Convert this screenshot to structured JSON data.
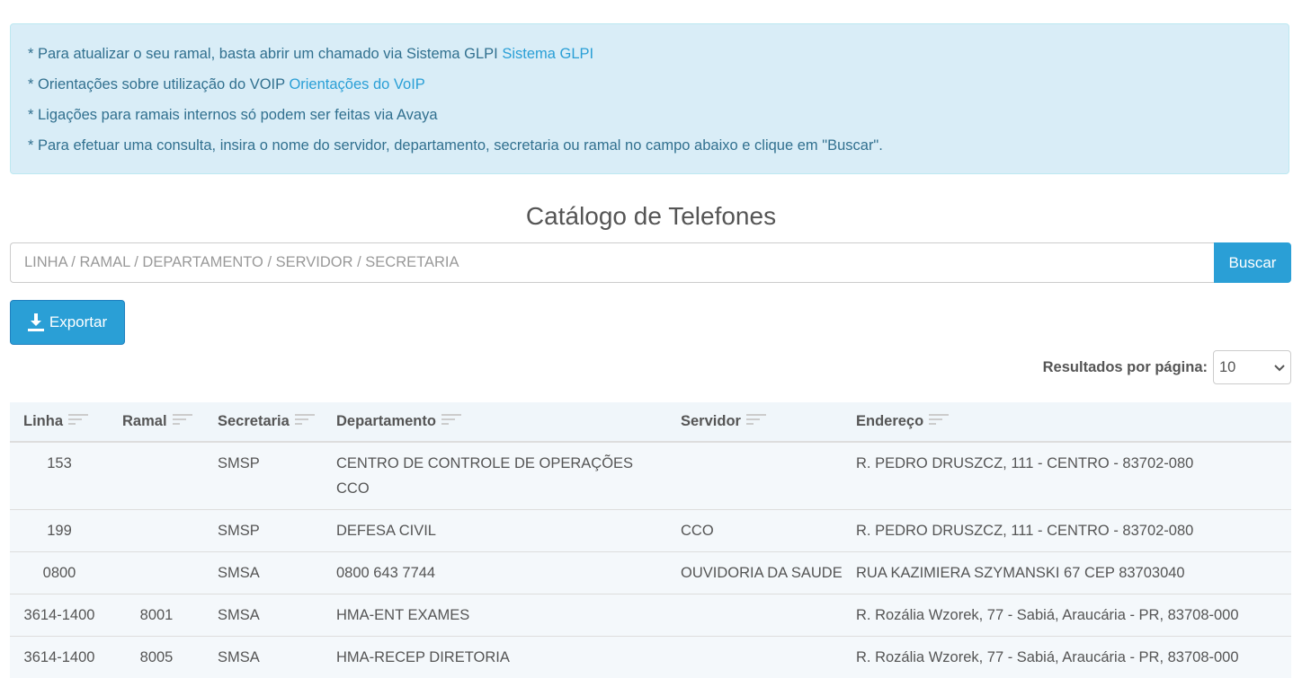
{
  "info": {
    "line1_text": "* Para atualizar o seu ramal, basta abrir um chamado via Sistema GLPI ",
    "line1_link": "Sistema GLPI",
    "line2_text": "* Orientações sobre utilização do VOIP ",
    "line2_link": "Orientações do VoIP",
    "line3_text": "* Ligações para ramais internos só podem ser feitas via Avaya",
    "line4_text": "* Para efetuar uma consulta, insira o nome do servidor, departamento, secretaria ou ramal no campo abaixo e clique em \"Buscar\"."
  },
  "title": "Catálogo de Telefones",
  "search": {
    "placeholder": "LINHA / RAMAL / DEPARTAMENTO / SERVIDOR / SECRETARIA",
    "button_label": "Buscar"
  },
  "export": {
    "label": "Exportar",
    "icon": "download-icon"
  },
  "per_page": {
    "label": "Resultados por página:",
    "value": "10"
  },
  "colors": {
    "primary": "#2a9fd6",
    "info_bg": "#d9edf7",
    "info_text": "#31708f"
  },
  "table": {
    "headers": [
      "Linha",
      "Ramal",
      "Secretaria",
      "Departamento",
      "Servidor",
      "Endereço"
    ],
    "rows": [
      [
        "153",
        "",
        "SMSP",
        "CENTRO DE CONTROLE DE OPERAÇÕES CCO",
        "",
        "R. PEDRO DRUSZCZ, 111 - CENTRO - 83702-080"
      ],
      [
        "199",
        "",
        "SMSP",
        "DEFESA CIVIL",
        "CCO",
        "R. PEDRO DRUSZCZ, 111 - CENTRO - 83702-080"
      ],
      [
        "0800",
        "",
        "SMSA",
        "0800 643 7744",
        "OUVIDORIA DA SAUDE",
        "RUA KAZIMIERA SZYMANSKI 67 CEP 83703040"
      ],
      [
        "3614-1400",
        "8001",
        "SMSA",
        "HMA-ENT EXAMES",
        "",
        "R. Rozália Wzorek, 77 - Sabiá, Araucária - PR, 83708-000"
      ],
      [
        "3614-1400",
        "8005",
        "SMSA",
        "HMA-RECEP DIRETORIA",
        "",
        "R. Rozália Wzorek, 77 - Sabiá, Araucária - PR, 83708-000"
      ]
    ]
  }
}
